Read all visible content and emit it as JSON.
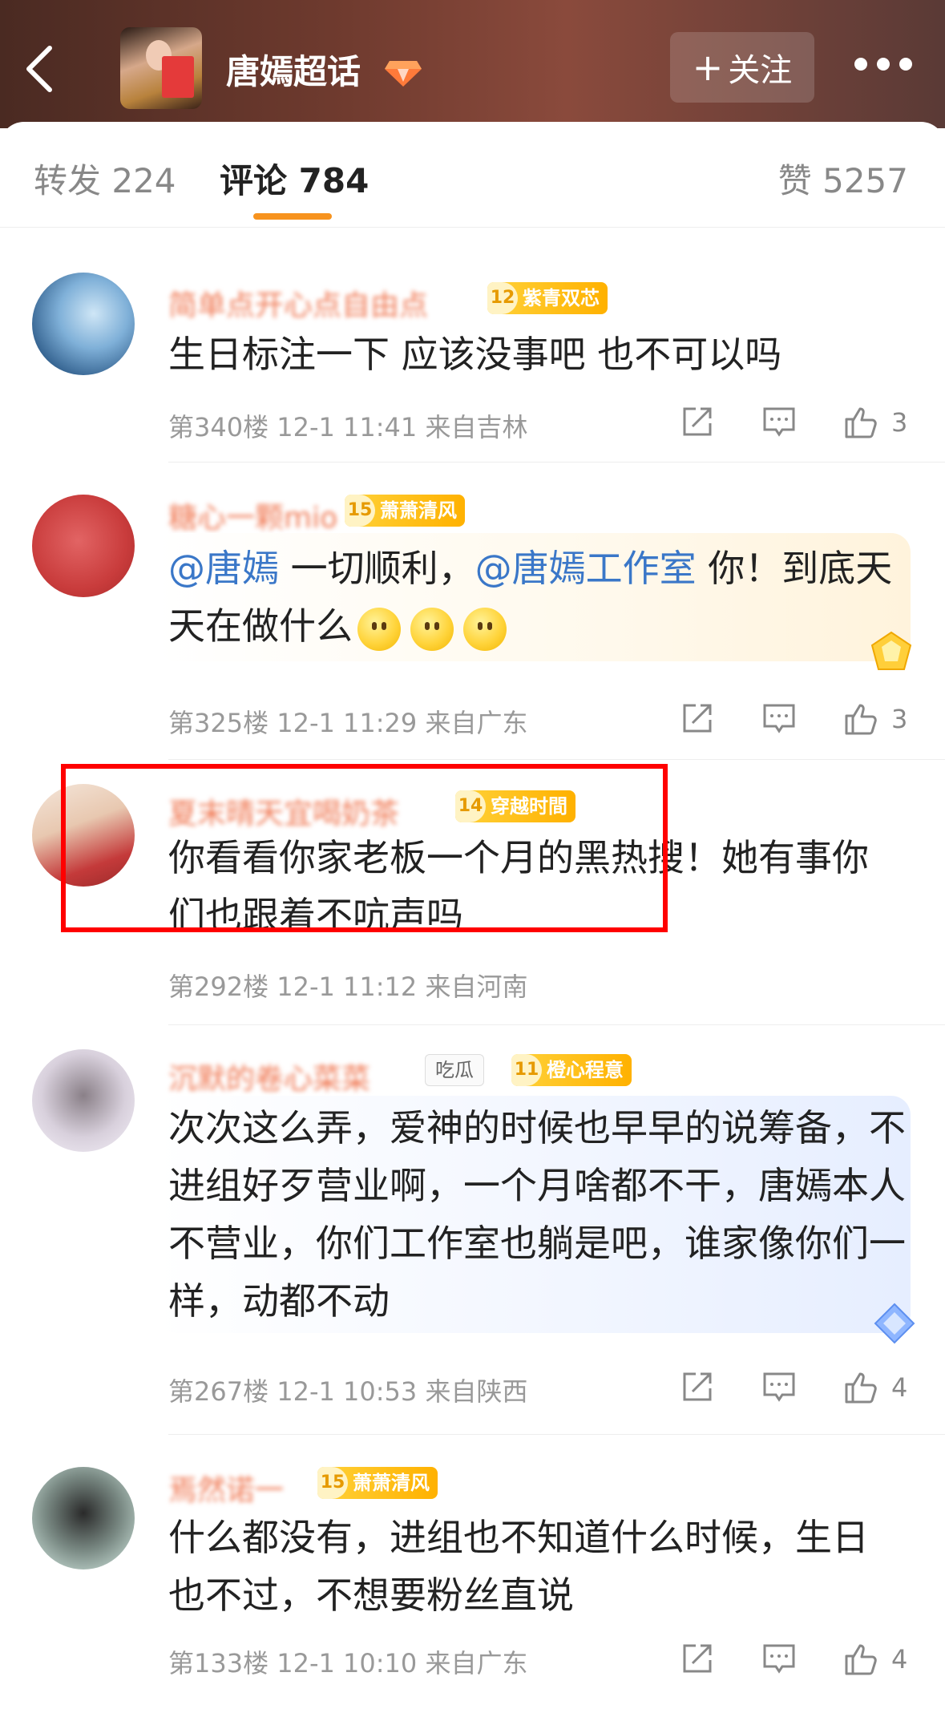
{
  "header": {
    "topic_title": "唐嫣超话",
    "follow_label": "关注",
    "follow_plus": "+"
  },
  "tabs": {
    "repost": "转发 224",
    "comment": "评论 784",
    "like": "赞 5257"
  },
  "comments": [
    {
      "name": "简单点开心点自由点",
      "badge_level": "12",
      "badge_label": "紫青双芯",
      "text": "生日标注一下 应该没事吧 也不可以吗",
      "meta": "第340楼 12-1 11:41 来自吉林",
      "likes": "3"
    },
    {
      "name": "糖心一颗mio",
      "badge_level": "15",
      "badge_label": "萧萧清风",
      "mention1": "@唐嫣",
      "text_mid": " 一切顺利，",
      "mention2": "@唐嫣工作室",
      "text_end": " 你！到底天天在做什么",
      "meta": "第325楼 12-1 11:29 来自广东",
      "likes": "3"
    },
    {
      "name": "夏末晴天宜喝奶茶",
      "badge_level": "14",
      "badge_label": "穿越时間",
      "text": "你看看你家老板一个月的黑热搜！她有事你们也跟着不吭声吗",
      "meta": "第292楼 12-1 11:12 来自河南"
    },
    {
      "name": "沉默的卷心菜菜",
      "tag": "吃瓜",
      "badge_level": "11",
      "badge_label": "橙心程意",
      "text": "次次这么弄，爱神的时候也早早的说筹备，不进组好歹营业啊，一个月啥都不干，唐嫣本人不营业，你们工作室也躺是吧，谁家像你们一样，动都不动",
      "meta": "第267楼 12-1 10:53 来自陕西",
      "likes": "4"
    },
    {
      "name": "焉然诺一",
      "badge_level": "15",
      "badge_label": "萧萧清风",
      "text": "什么都没有，进组也不知道什么时候，生日也不过，不想要粉丝直说",
      "meta": "第133楼 12-1 10:10 来自广东",
      "likes": "4"
    }
  ],
  "colors": {
    "accent": "#f7931e",
    "mention": "#3a77c8",
    "highlight": "#ff0000"
  }
}
